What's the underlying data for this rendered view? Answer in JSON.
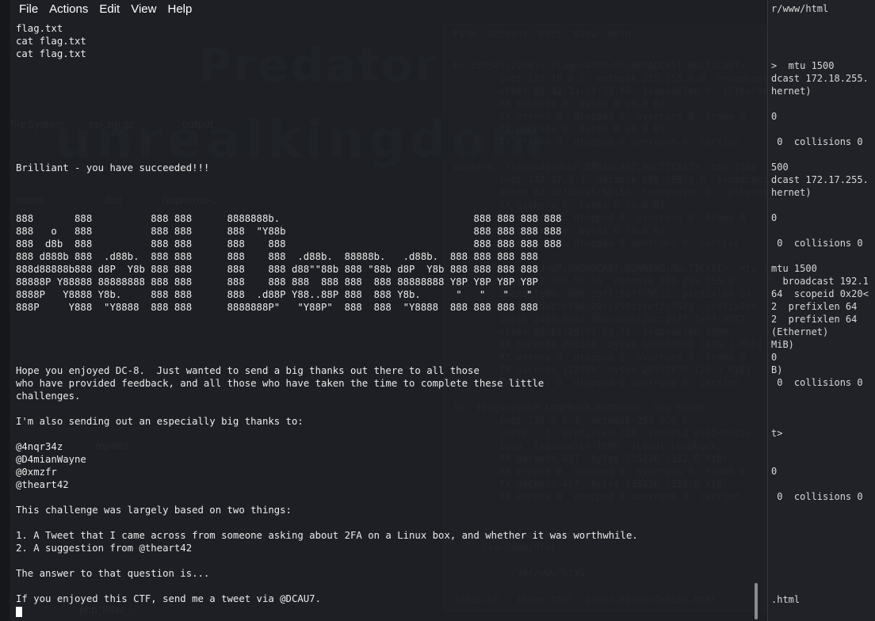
{
  "menubar": {
    "items": [
      "File",
      "Actions",
      "Edit",
      "View",
      "Help"
    ]
  },
  "terminal": {
    "lines": [
      "flag.txt",
      "cat flag.txt",
      "cat flag.txt",
      "",
      "",
      "",
      "",
      "",
      "",
      "",
      "",
      "Brilliant - you have succeeded!!!",
      "",
      "",
      "",
      "888       888          888 888      8888888b.                                 888 888 888 888",
      "888   o   888          888 888      888  \"Y88b                                888 888 888 888",
      "888  d8b  888          888 888      888    888                                888 888 888 888",
      "888 d888b 888  .d88b.  888 888      888    888  .d88b.  88888b.   .d88b.  888 888 888 888",
      "888d88888b888 d8P  Y8b 888 888      888    888 d88\"\"88b 888 \"88b d8P  Y8b 888 888 888 888",
      "88888P Y88888 88888888 888 888      888    888 888  888 888  888 88888888 Y8P Y8P Y8P Y8P",
      "8888P   Y8888 Y8b.     888 888      888  .d88P Y88..88P 888  888 Y8b.      \"   \"   \"   \"",
      "888P     Y888  \"Y8888  888 888      8888888P\"   \"Y88P\"  888  888  \"Y8888  888 888 888 888",
      "",
      "",
      "",
      "",
      "Hope you enjoyed DC-8.  Just wanted to send a big thanks out there to all those",
      "who have provided feedback, and all those who have taken the time to complete these little",
      "challenges.",
      "",
      "I'm also sending out an especially big thanks to:",
      "",
      "@4nqr34z",
      "@D4mianWayne",
      "@0xmzfr",
      "@theart42",
      "",
      "This challenge was largely based on two things:",
      "",
      "1. A Tweet that I came across from someone asking about 2FA on a Linux box, and whether it was worthwhile.",
      "2. A suggestion from @theart42",
      "",
      "The answer to that question is...",
      "",
      "If you enjoyed this CTF, send me a tweet via @DCAU7."
    ]
  },
  "background": {
    "right_lines": [
      [
        16,
        "r/www/html"
      ],
      [
        88,
        ">  mtu 1500"
      ],
      [
        104,
        "dcast 172.18.255."
      ],
      [
        120,
        "hernet)"
      ],
      [
        152,
        "0"
      ],
      [
        184,
        " 0  collisions 0"
      ],
      [
        216,
        "500"
      ],
      [
        232,
        "dcast 172.17.255."
      ],
      [
        248,
        "hernet)"
      ],
      [
        280,
        "0"
      ],
      [
        312,
        " 0  collisions 0"
      ],
      [
        344,
        "mtu 1500"
      ],
      [
        360,
        "  broadcast 192.1"
      ],
      [
        376,
        "64  scopeid 0x20<"
      ],
      [
        392,
        "2  prefixlen 64"
      ],
      [
        408,
        "2  prefixlen 64"
      ],
      [
        424,
        "(Ethernet)"
      ],
      [
        440,
        "MiB)"
      ],
      [
        456,
        "0"
      ],
      [
        472,
        "B)"
      ],
      [
        488,
        " 0  collisions 0"
      ],
      [
        552,
        "t>"
      ],
      [
        600,
        "0"
      ],
      [
        632,
        " 0  collisions 0"
      ],
      [
        762,
        ".html"
      ]
    ],
    "ghost_lines": [
      [
        48,
        "File  Actions  Edit  View  Help"
      ],
      [
        88,
        "br-c885e7c22641: flags=4099<UP,BROADCAST,MULTICAST>"
      ],
      [
        104,
        "        inet 172.18.0.1  netmask 255.255.0.0  broadcast"
      ],
      [
        120,
        "        ether 02:42:3a:c9:32:f6  txqueuelen 0  (Ethernet)"
      ],
      [
        136,
        "        RX packets 0  bytes 0 (0.0 B)"
      ],
      [
        152,
        "        RX errors 0  dropped 0  overruns 0  frame 0"
      ],
      [
        168,
        "        TX packets 0  bytes 0 (0.0 B)"
      ],
      [
        184,
        "        TX errors 0  dropped 0 overruns 0  carrier"
      ],
      [
        216,
        "docker0: flags=4099<UP,BROADCAST,MULTICAST>  mtu 1500"
      ],
      [
        232,
        "        inet 172.17.0.1  netmask 255.255.0.0  broadcast"
      ],
      [
        248,
        "        ether 02:42:3b:a5:5b:5c  txqueuelen 0  (Ethernet)"
      ],
      [
        264,
        "        RX packets 0  bytes 0 (0.0 B)"
      ],
      [
        280,
        "        RX errors 0  dropped 0  overruns 0  frame 0"
      ],
      [
        296,
        "        TX packets 0  bytes 0 (0.0 B)"
      ],
      [
        312,
        "        TX errors 0  dropped 0 overruns 0  carrier"
      ],
      [
        344,
        "eth0: flags=4163<UP,BROADCAST,RUNNING,MULTICAST>  mtu 1500"
      ],
      [
        360,
        "        inet 192.168.56.58  netmask 255.255.255.0"
      ],
      [
        376,
        "        inet6 fe80::a00:29ff:feff:9572  prefixlen 64"
      ],
      [
        392,
        "        inet6 fdab:cf00:20c:29ff:feff:9572  prefixlen"
      ],
      [
        408,
        "        inet6 2409:895a:86b:d6cc:20c:29ff:feff:9572"
      ],
      [
        424,
        "        ether 00:0c:29:ff:95:72  txqueuelen 1000"
      ],
      [
        440,
        "        RX packets 298110  bytes 183610698 (175.1 MiB)"
      ],
      [
        456,
        "        RX errors 0  dropped 0  overruns 0  frame 0"
      ],
      [
        472,
        "        TX packets 122776  bytes 26577839 (25.3 MiB)"
      ],
      [
        488,
        "        TX errors 0  dropped 0 overruns 0  carrier"
      ],
      [
        520,
        "lo: flags=73<UP,LOOPBACK,RUNNING>  mtu 65536"
      ],
      [
        536,
        "        inet 127.0.0.1  netmask 255.0.0.0"
      ],
      [
        552,
        "        inet6 ::1  prefixlen 128  scopeid 0x10<host>"
      ],
      [
        568,
        "        loop  txqueuelen 1000  (Local Loopback)"
      ],
      [
        584,
        "        RX packets 457  bytes 135236 (132.0 KiB)"
      ],
      [
        600,
        "        RX errors 0  dropped 0  overruns 0  frame 0"
      ],
      [
        616,
        "        TX packets 457  bytes 135236 (132.0 KiB)"
      ],
      [
        632,
        "        TX errors 0  dropped 0 overruns 0  carrier"
      ],
      [
        680,
        "          /home/kali666"
      ],
      [
        696,
        "     /var/www/html"
      ],
      [
        728,
        "          /var/www/html"
      ],
      [
        762,
        "39535.sh   index.html  index.nginx-debian.html"
      ]
    ]
  },
  "ghost_labels": [
    [
      12,
      150,
      "File System"
    ],
    [
      112,
      150,
      "ppl.zip.gz"
    ],
    [
      230,
      150,
      "output"
    ],
    [
      20,
      246,
      "Home"
    ],
    [
      132,
      246,
      "dict"
    ],
    [
      204,
      246,
      "Gopherus-..."
    ],
    [
      120,
      556,
      "reports"
    ],
    [
      100,
      763,
      "php_filter_..."
    ]
  ]
}
